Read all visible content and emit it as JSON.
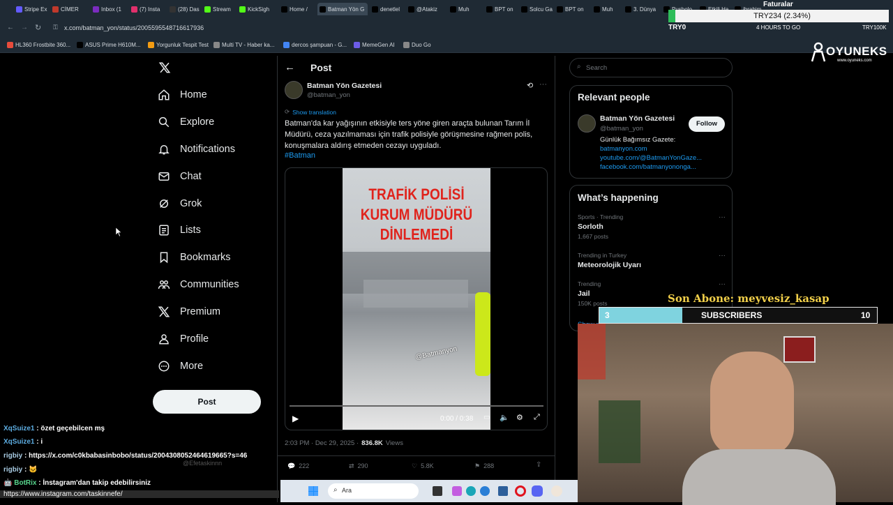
{
  "browser": {
    "tabs": [
      {
        "label": "Stripe Ex",
        "color": "#635bff"
      },
      {
        "label": "CİMER",
        "color": "#c0392b"
      },
      {
        "label": "Inbox (1",
        "color": "#7b2cbf"
      },
      {
        "label": "(7) Insta",
        "color": "#e1306c"
      },
      {
        "label": "(28) Das",
        "color": "#333"
      },
      {
        "label": "Stream",
        "color": "#53fc18"
      },
      {
        "label": "KickSigh",
        "color": "#53fc18"
      },
      {
        "label": "Home /",
        "color": "#000"
      },
      {
        "label": "Batman Yön G",
        "color": "#000"
      },
      {
        "label": "denetlel",
        "color": "#000"
      },
      {
        "label": "@Atakiz",
        "color": "#000"
      },
      {
        "label": "Muh",
        "color": "#000"
      },
      {
        "label": "BPT on",
        "color": "#000"
      },
      {
        "label": "Solcu Ga",
        "color": "#000"
      },
      {
        "label": "BPT on",
        "color": "#000"
      },
      {
        "label": "Muh",
        "color": "#000"
      },
      {
        "label": "3. Dünya",
        "color": "#000"
      },
      {
        "label": "Pusholo",
        "color": "#000"
      },
      {
        "label": "Etkili Ha",
        "color": "#000"
      },
      {
        "label": "ibrahim",
        "color": "#000"
      }
    ],
    "url": "x.com/batman_yon/status/2005595548716617936",
    "bookmarks": [
      {
        "label": "HL360 Frostbite 360...",
        "color": "#e74c3c"
      },
      {
        "label": "ASUS Prime H610M...",
        "color": "#000"
      },
      {
        "label": "Yorgunluk Tespit Test",
        "color": "#f39c12"
      },
      {
        "label": "Multi TV - Haber ka...",
        "color": "#888"
      },
      {
        "label": "dercos şampuan - G...",
        "color": "#4285f4"
      },
      {
        "label": "MemeGen AI",
        "color": "#6c5ce7"
      },
      {
        "label": "Duo Go",
        "color": "#888"
      }
    ]
  },
  "overlay": {
    "faturalar": "Faturalar",
    "try_ticker": "TRY234 (2.34%)",
    "try0": "TRY0",
    "hours": "4 HOURS TO GO",
    "try100": "TRY100K",
    "brand": "OYUNEKS",
    "brand_sub": "www.oyuneks.com",
    "son_abone": "Son Abone: meyvesiz_kasap",
    "subs_current": "3",
    "subs_label": "SUBSCRIBERS",
    "subs_goal": "10",
    "subs_progress": 0.3
  },
  "nav": {
    "items": [
      {
        "label": "Home",
        "icon": "home-icon"
      },
      {
        "label": "Explore",
        "icon": "search-icon"
      },
      {
        "label": "Notifications",
        "icon": "bell-icon"
      },
      {
        "label": "Chat",
        "icon": "mail-icon"
      },
      {
        "label": "Grok",
        "icon": "grok-icon"
      },
      {
        "label": "Lists",
        "icon": "list-icon"
      },
      {
        "label": "Bookmarks",
        "icon": "bookmark-icon"
      },
      {
        "label": "Communities",
        "icon": "communities-icon"
      },
      {
        "label": "Premium",
        "icon": "x-logo-icon"
      },
      {
        "label": "Profile",
        "icon": "person-icon"
      },
      {
        "label": "More",
        "icon": "more-icon"
      }
    ],
    "post_button": "Post"
  },
  "post": {
    "header": "Post",
    "author_name": "Batman Yön Gazetesi",
    "author_handle": "@batman_yon",
    "show_translation": "Show translation",
    "text": "Batman'da kar yağışının etkisiyle ters yöne giren araçta bulunan Tarım İl Müdürü, ceza yazılmaması için trafik polisiyle görüşmesine rağmen polis, konuşmalara aldırış etmeden cezayı uyguladı.",
    "hashtag": "#Batman",
    "video_caption_lines": [
      "TRAFİK POLİSİ",
      "KURUM MÜDÜRÜ",
      "DİNLEMEDİ"
    ],
    "watermark": "@Batmanyon",
    "video_time": "0:00 / 0:38",
    "timestamp": "2:03 PM · Dec 29, 2025 ·",
    "views_count": "836.8K",
    "views_label": "Views",
    "replies": "222",
    "reposts": "290",
    "likes": "5.8K",
    "bookmarks": "288"
  },
  "sidebar": {
    "search_placeholder": "Search",
    "relevant_title": "Relevant people",
    "person_name": "Batman Yön Gazetesi",
    "person_handle": "@batman_yon",
    "follow": "Follow",
    "bio": "Günlük Bağımsız Gazete:",
    "links": [
      "batmanyon.com",
      "youtube.com/@BatmanYonGaze...",
      "facebook.com/batmanyononga..."
    ],
    "happening_title": "What’s happening",
    "trends": [
      {
        "context": "Sports · Trending",
        "name": "Sorloth",
        "posts": "1,667 posts"
      },
      {
        "context": "Trending in Turkey",
        "name": "Meteorolojik Uyarı",
        "posts": ""
      },
      {
        "context": "Trending",
        "name": "Jail",
        "posts": "150K posts"
      }
    ],
    "show_more": "Show more"
  },
  "chat": {
    "messages": [
      {
        "user": "XqSuize1",
        "text": "özet geçebilcen mş",
        "color": "#5dade2"
      },
      {
        "user": "XqSuize1",
        "text": "i",
        "color": "#5dade2"
      },
      {
        "user": "rigbiy",
        "text": "https://x.com/c0kbabasinbobo/status/2004308052464619665?s=46",
        "color": "#a9cce3"
      },
      {
        "user": "rigbiy",
        "text": "🐱",
        "color": "#a9cce3"
      },
      {
        "user": "BotRix",
        "text": "İnstagram'dan takip edebilirsiniz",
        "color": "#58d68d"
      },
      {
        "user": "",
        "text": "https://www.instagram.com/taskinnefe/",
        "color": "#fff"
      }
    ],
    "ghost_handle": "@Efetaskinnn"
  },
  "taskbar": {
    "search": "Ara"
  }
}
